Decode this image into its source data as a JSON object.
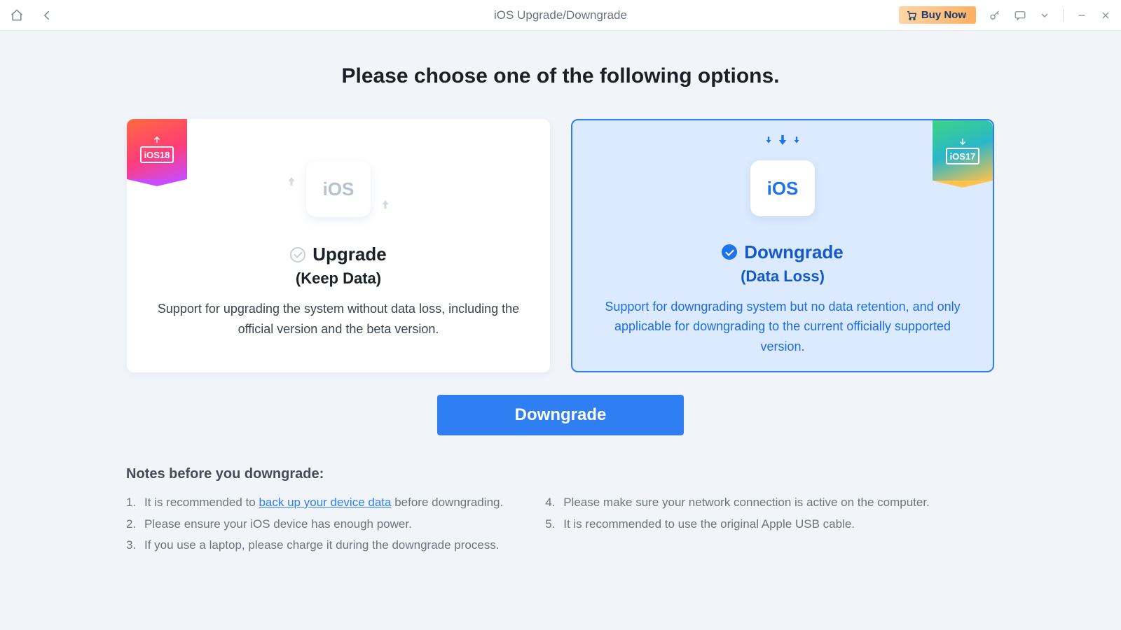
{
  "titlebar": {
    "title": "iOS Upgrade/Downgrade",
    "buy_now": "Buy Now"
  },
  "heading": "Please choose one of the following options.",
  "cards": {
    "upgrade": {
      "ribbon": "iOS18",
      "illus_text": "iOS",
      "title": "Upgrade",
      "subtitle": "(Keep Data)",
      "desc": "Support for upgrading the system without data loss, including the official version and the beta version."
    },
    "downgrade": {
      "ribbon": "iOS17",
      "illus_text": "iOS",
      "title": "Downgrade",
      "subtitle": "(Data Loss)",
      "desc": "Support for downgrading system but no data retention, and only applicable for downgrading to the current officially supported version."
    }
  },
  "action_button": "Downgrade",
  "notes": {
    "title": "Notes before you downgrade:",
    "backup_link_text": "back up your device data",
    "items_left": [
      {
        "num": "1.",
        "pre": "It is recommended to ",
        "post": " before downgrading."
      },
      {
        "num": "2.",
        "text": "Please ensure your iOS device has enough power."
      },
      {
        "num": "3.",
        "text": "If you use a laptop, please charge it during the downgrade process."
      }
    ],
    "items_right": [
      {
        "num": "4.",
        "text": "Please make sure your network connection is active on the computer."
      },
      {
        "num": "5.",
        "text": "It is recommended to use the original Apple USB cable."
      }
    ]
  }
}
